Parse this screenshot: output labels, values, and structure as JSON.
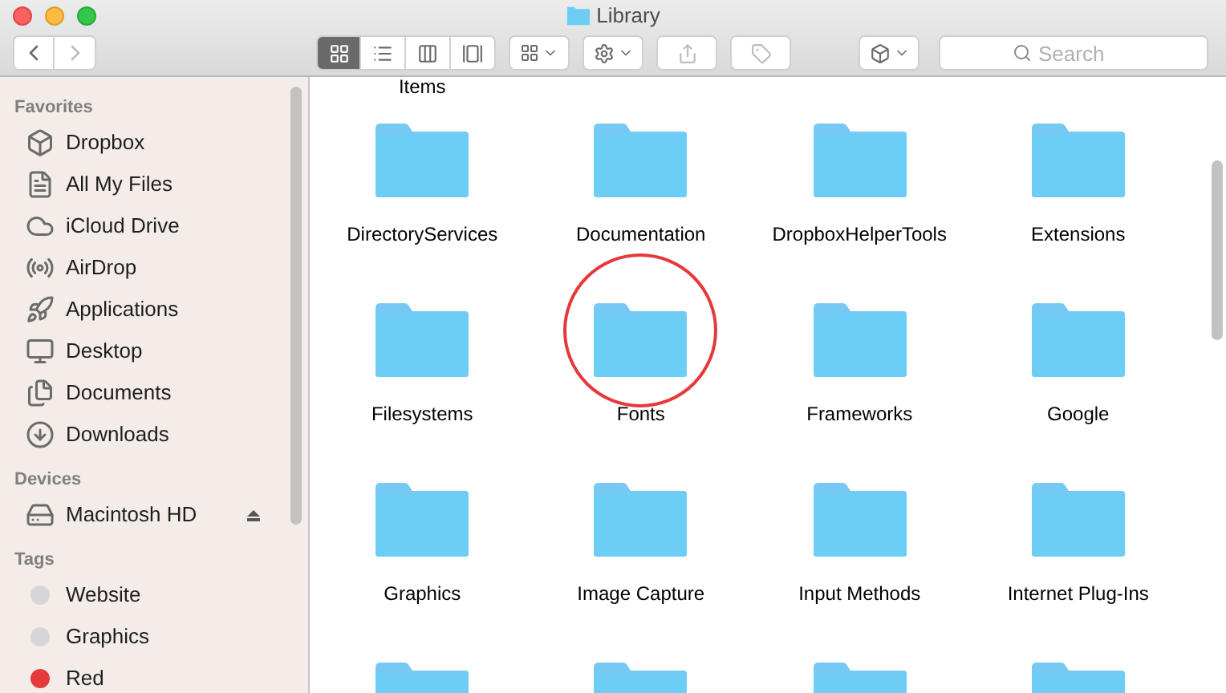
{
  "window": {
    "title": "Library"
  },
  "toolbar": {
    "views": [
      {
        "kind": "icons",
        "selected": true
      },
      {
        "kind": "list",
        "selected": false
      },
      {
        "kind": "columns",
        "selected": false
      },
      {
        "kind": "coverflow",
        "selected": false
      }
    ],
    "search": {
      "placeholder": "Search"
    }
  },
  "sidebar": {
    "sections": [
      {
        "title": "Favorites",
        "items": [
          {
            "label": "Dropbox",
            "kind": "dropbox"
          },
          {
            "label": "All My Files",
            "kind": "allfiles"
          },
          {
            "label": "iCloud Drive",
            "kind": "cloud"
          },
          {
            "label": "AirDrop",
            "kind": "airdrop"
          },
          {
            "label": "Applications",
            "kind": "apps"
          },
          {
            "label": "Desktop",
            "kind": "desktop"
          },
          {
            "label": "Documents",
            "kind": "documents"
          },
          {
            "label": "Downloads",
            "kind": "downloads"
          }
        ]
      },
      {
        "title": "Devices",
        "items": [
          {
            "label": "Macintosh HD",
            "kind": "disk",
            "ejectable": true
          }
        ]
      },
      {
        "title": "Tags",
        "items": [
          {
            "label": "Website",
            "kind": "tag",
            "color": "#d6d6d6"
          },
          {
            "label": "Graphics",
            "kind": "tag",
            "color": "#d6d6d6"
          },
          {
            "label": "Red",
            "kind": "tag",
            "color": "#e63b3b"
          }
        ]
      }
    ]
  },
  "content": {
    "partial_top_label": "Items",
    "folders": [
      {
        "name": "DirectoryServices",
        "circled": false
      },
      {
        "name": "Documentation",
        "circled": false
      },
      {
        "name": "DropboxHelperTools",
        "circled": false
      },
      {
        "name": "Extensions",
        "circled": false
      },
      {
        "name": "Filesystems",
        "circled": false
      },
      {
        "name": "Fonts",
        "circled": true
      },
      {
        "name": "Frameworks",
        "circled": false
      },
      {
        "name": "Google",
        "circled": false
      },
      {
        "name": "Graphics",
        "circled": false
      },
      {
        "name": "Image Capture",
        "circled": false
      },
      {
        "name": "Input Methods",
        "circled": false
      },
      {
        "name": "Internet Plug-Ins",
        "circled": false
      }
    ],
    "has_more_rows": true
  }
}
